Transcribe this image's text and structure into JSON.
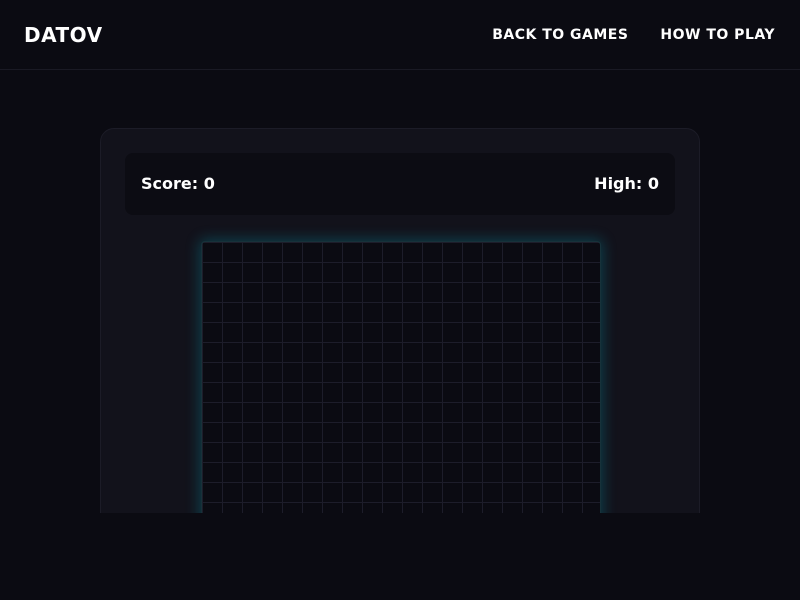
{
  "header": {
    "logo": "DATOV",
    "nav": [
      {
        "label": "BACK TO GAMES"
      },
      {
        "label": "HOW TO PLAY"
      }
    ]
  },
  "game": {
    "score_label": "Score: 0",
    "high_label": "High: 0",
    "score": 0,
    "high": 0
  },
  "colors": {
    "background": "#0b0b12",
    "panel": "#12121b",
    "grid_glow": "#00b4c8"
  }
}
